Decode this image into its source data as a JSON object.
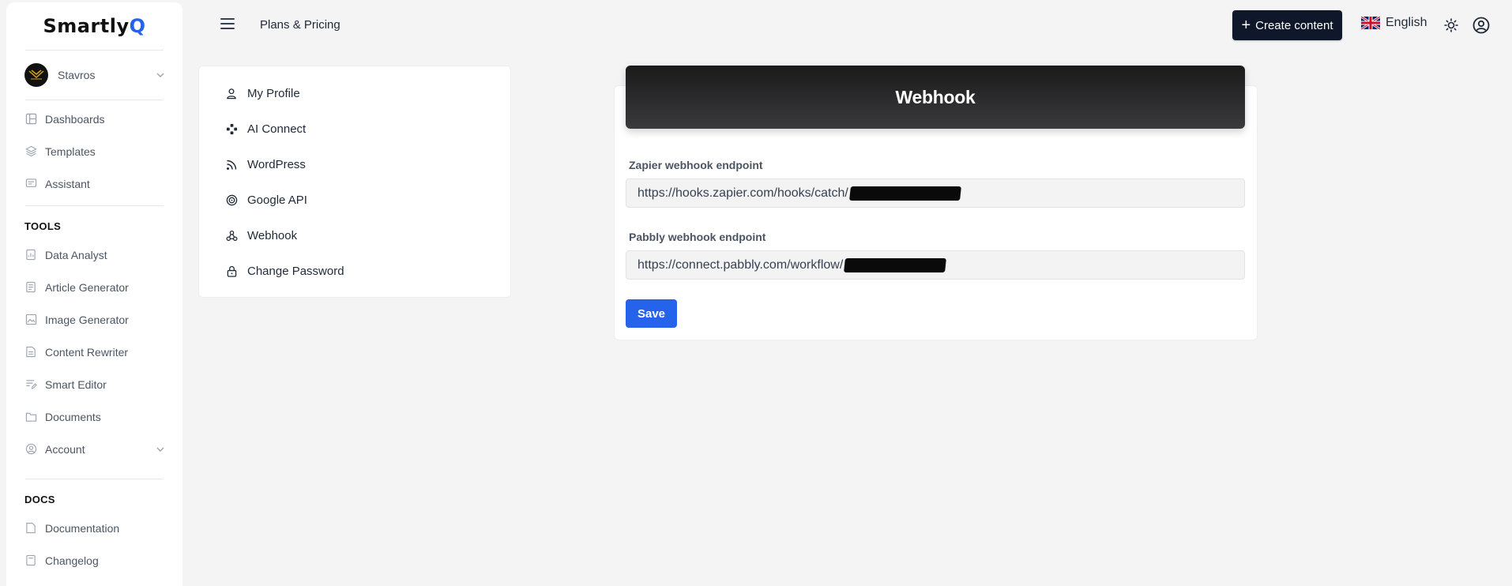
{
  "app": {
    "brand_main": "Smartly",
    "brand_accent": "Q",
    "accent_color": "#2563eb"
  },
  "sidebar": {
    "user": {
      "name": "Stavros"
    },
    "main_items": [
      {
        "label": "Dashboards",
        "icon": "dashboard-icon"
      },
      {
        "label": "Templates",
        "icon": "layers-icon"
      },
      {
        "label": "Assistant",
        "icon": "chat-icon"
      }
    ],
    "tools_title": "TOOLS",
    "tools_items": [
      {
        "label": "Data Analyst",
        "icon": "file-chart-icon"
      },
      {
        "label": "Article Generator",
        "icon": "article-icon"
      },
      {
        "label": "Image Generator",
        "icon": "image-icon"
      },
      {
        "label": "Content Rewriter",
        "icon": "document-icon"
      },
      {
        "label": "Smart Editor",
        "icon": "edit-lines-icon"
      },
      {
        "label": "Documents",
        "icon": "folder-icon"
      },
      {
        "label": "Account",
        "icon": "user-circle-icon"
      }
    ],
    "docs_title": "DOCS",
    "docs_items": [
      {
        "label": "Documentation",
        "icon": "doc-icon"
      },
      {
        "label": "Changelog",
        "icon": "changelog-icon"
      }
    ]
  },
  "header": {
    "breadcrumb": "Plans & Pricing",
    "create_label": "Create content",
    "language": "English"
  },
  "settings_menu": [
    {
      "label": "My Profile",
      "icon": "user-icon"
    },
    {
      "label": "AI Connect",
      "icon": "connect-icon"
    },
    {
      "label": "WordPress",
      "icon": "rss-icon"
    },
    {
      "label": "Google API",
      "icon": "target-icon"
    },
    {
      "label": "Webhook",
      "icon": "webhook-icon"
    },
    {
      "label": "Change Password",
      "icon": "lock-icon"
    }
  ],
  "webhook": {
    "title": "Webhook",
    "zapier_label": "Zapier webhook endpoint",
    "zapier_value": "https://hooks.zapier.com/hooks/catch/",
    "pabbly_label": "Pabbly webhook endpoint",
    "pabbly_value": "https://connect.pabbly.com/workflow/",
    "save_label": "Save"
  }
}
